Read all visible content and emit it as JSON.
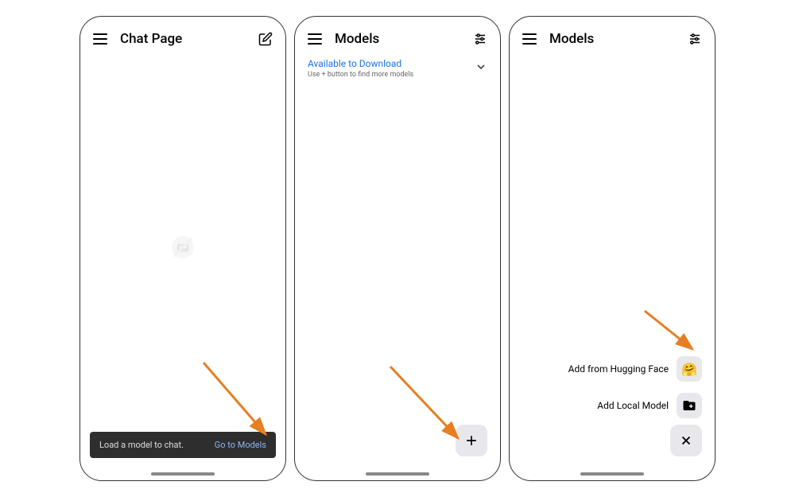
{
  "screen1": {
    "title": "Chat Page",
    "bottomBarText": "Load a model to chat.",
    "bottomBarLink": "Go to Models"
  },
  "screen2": {
    "title": "Models",
    "sectionTitle": "Available to Download",
    "sectionSubtitle": "Use + button to find more models"
  },
  "screen3": {
    "title": "Models",
    "option1": "Add from Hugging Face",
    "option2": "Add Local Model"
  }
}
